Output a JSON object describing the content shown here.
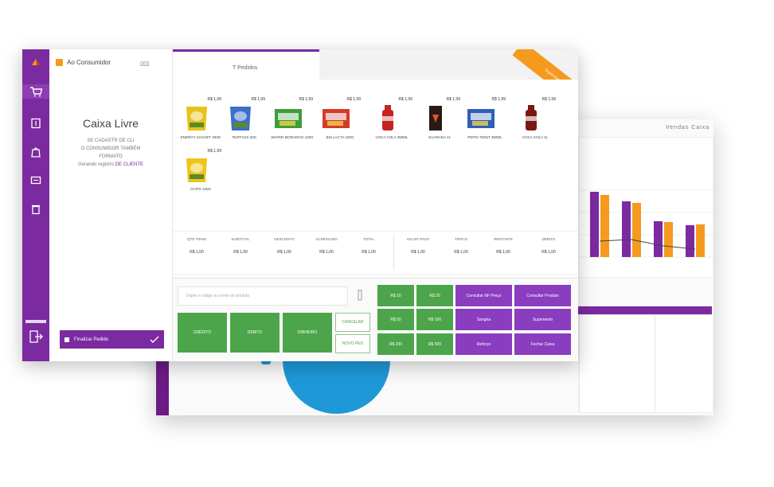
{
  "colors": {
    "purple": "#7b2aa0",
    "orange": "#f59a1f",
    "green": "#4ca54a",
    "blue": "#1f98d8"
  },
  "sidebar": {
    "items": [
      {
        "name": "cart-icon"
      },
      {
        "name": "document-icon"
      },
      {
        "name": "bag-icon"
      },
      {
        "name": "monitor-icon"
      },
      {
        "name": "trash-icon"
      }
    ],
    "exit_icon": "logout-icon"
  },
  "left_panel": {
    "client": "Ao Consumidor",
    "top_right": "▯▯▯",
    "title": "Caixa Livre",
    "info": [
      "SE CADASTR DE CLI",
      "O CONSUMIDOR TAMBÉM",
      "FORMATO",
      "Gerando registro"
    ],
    "info_highlight": "DE CLIENTE",
    "pay_label": "Finalizar Pedido"
  },
  "tab": {
    "label": "T  Pedidos"
  },
  "ribbon": "Supermercado",
  "products": [
    {
      "price": "R$ 1,99",
      "name": "ENERGY SACHET 200G",
      "img": "chips-bag"
    },
    {
      "price": "R$ 1,99",
      "name": "RUFFLES 60G",
      "img": "chips-blue"
    },
    {
      "price": "R$ 1,99",
      "name": "WAFER MORANGO 100G",
      "img": "box-green"
    },
    {
      "price": "R$ 1,99",
      "name": "BIS LACTA 100G",
      "img": "box-red"
    },
    {
      "price": "R$ 1,99",
      "name": "COCA COLA 350ML",
      "img": "bottle-red"
    },
    {
      "price": "R$ 1,99",
      "name": "GUARANA 2L",
      "img": "can-dark"
    },
    {
      "price": "R$ 1,99",
      "name": "PEPSI TWIST 350ML",
      "img": "box-blue"
    },
    {
      "price": "R$ 1,99",
      "name": "COCA COLA 2L",
      "img": "bottle-dark"
    },
    {
      "price": "R$ 1,99",
      "name": "CHIPS 100G",
      "img": "chips-yellow"
    }
  ],
  "totals": [
    {
      "label": "QTD ITENS",
      "value": "R$ 1,00"
    },
    {
      "label": "SUBTOTAL",
      "value": "R$ 1,00"
    },
    {
      "label": "DESCONTO",
      "value": "R$ 1,00"
    },
    {
      "label": "ACRÉSCIMO",
      "value": "R$ 1,00"
    },
    {
      "label": "TOTAL",
      "value": "R$ 1,00"
    },
    {
      "label": "VALOR PAGO",
      "value": "R$ 1,00"
    },
    {
      "label": "TROCO",
      "value": "R$ 1,00"
    },
    {
      "label": "RESTANTE",
      "value": "R$ 1,00"
    },
    {
      "label": "DÉBITO",
      "value": "R$ 1,00"
    }
  ],
  "search": {
    "placeholder": "Digite o código ou nome do produto"
  },
  "green_buttons": [
    "CRÉDITO",
    "DÉBITO",
    "DINHEIRO"
  ],
  "outline_buttons": [
    "CANCELAR",
    "NOVO PED"
  ],
  "quick_buttons": [
    "R$ 10",
    "R$ 20",
    "R$ 50",
    "R$ 100",
    "R$ 200",
    "R$ 500"
  ],
  "purple_buttons": [
    "Consultar NF Preço",
    "Consultar Produto",
    "Sangria",
    "Suprimento",
    "Reforço",
    "Fechar Caixa"
  ],
  "dashboard": {
    "title": "Vendas  Caixa",
    "chart_data": {
      "type": "bar",
      "series": [
        {
          "values": [
            82,
            70,
            45,
            40
          ]
        },
        {
          "values": [
            78,
            68,
            44,
            41
          ]
        }
      ],
      "line": [
        20,
        22,
        14,
        10
      ]
    }
  }
}
